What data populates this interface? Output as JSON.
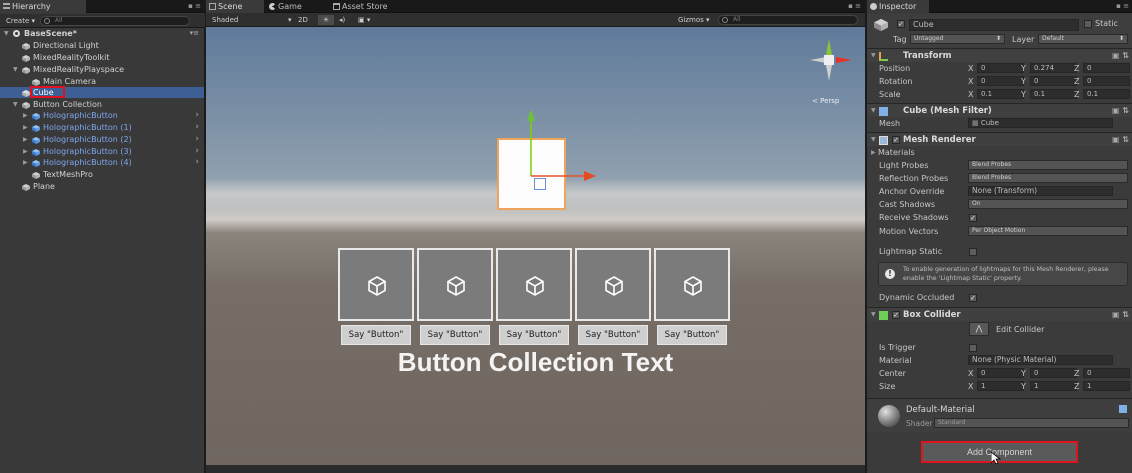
{
  "hierarchy": {
    "tab": "Hierarchy",
    "create": "Create",
    "search_placeholder": "All",
    "scene": "BaseScene*",
    "items": [
      {
        "label": "Directional Light"
      },
      {
        "label": "MixedRealityToolkit"
      },
      {
        "label": "MixedRealityPlayspace"
      },
      {
        "label": "Main Camera"
      },
      {
        "label": "Cube"
      },
      {
        "label": "Button Collection"
      },
      {
        "label": "HolographicButton"
      },
      {
        "label": "HolographicButton (1)"
      },
      {
        "label": "HolographicButton (2)"
      },
      {
        "label": "HolographicButton (3)"
      },
      {
        "label": "HolographicButton (4)"
      },
      {
        "label": "TextMeshPro"
      },
      {
        "label": "Plane"
      }
    ]
  },
  "scene": {
    "tabs": [
      "Scene",
      "Game",
      "Asset Store"
    ],
    "shading": "Shaded",
    "mode_2d": "2D",
    "gizmos": "Gizmos",
    "search_placeholder": "All",
    "persp": "Persp",
    "buttons": [
      "Say \"Button\"",
      "Say \"Button\"",
      "Say \"Button\"",
      "Say \"Button\"",
      "Say \"Button\""
    ],
    "collection_text": "Button Collection Text"
  },
  "inspector": {
    "tab": "Inspector",
    "object_name": "Cube",
    "static": "Static",
    "tag_label": "Tag",
    "tag": "Untagged",
    "layer_label": "Layer",
    "layer": "Default",
    "transform": {
      "title": "Transform",
      "position_label": "Position",
      "position": {
        "x": "0",
        "y": "0.274",
        "z": "0"
      },
      "rotation_label": "Rotation",
      "rotation": {
        "x": "0",
        "y": "0",
        "z": "0"
      },
      "scale_label": "Scale",
      "scale": {
        "x": "0.1",
        "y": "0.1",
        "z": "0.1"
      }
    },
    "mesh_filter": {
      "title": "Cube (Mesh Filter)",
      "mesh_label": "Mesh",
      "mesh": "Cube"
    },
    "mesh_renderer": {
      "title": "Mesh Renderer",
      "materials": "Materials",
      "light_probes_label": "Light Probes",
      "light_probes": "Blend Probes",
      "reflection_probes_label": "Reflection Probes",
      "reflection_probes": "Blend Probes",
      "anchor_override_label": "Anchor Override",
      "anchor_override": "None (Transform)",
      "cast_shadows_label": "Cast Shadows",
      "cast_shadows": "On",
      "receive_shadows_label": "Receive Shadows",
      "motion_vectors_label": "Motion Vectors",
      "motion_vectors": "Per Object Motion",
      "lightmap_static_label": "Lightmap Static",
      "info_line1": "To enable generation of lightmaps for this Mesh Renderer, please",
      "info_line2": "enable the 'Lightmap Static' property.",
      "dynamic_occluded_label": "Dynamic Occluded"
    },
    "box_collider": {
      "title": "Box Collider",
      "edit_collider": "Edit Collider",
      "is_trigger_label": "Is Trigger",
      "material_label": "Material",
      "material": "None (Physic Material)",
      "center_label": "Center",
      "center": {
        "x": "0",
        "y": "0",
        "z": "0"
      },
      "size_label": "Size",
      "size": {
        "x": "1",
        "y": "1",
        "z": "1"
      }
    },
    "material": {
      "name": "Default-Material",
      "shader_label": "Shader",
      "shader": "Standard"
    },
    "add_component": "Add Component"
  },
  "axis_labels": {
    "x": "X",
    "y": "Y",
    "z": "Z"
  },
  "colors": {
    "selection": "#3e5f96",
    "highlight": "#e0141e",
    "prefab_text": "#7ca7ee"
  }
}
